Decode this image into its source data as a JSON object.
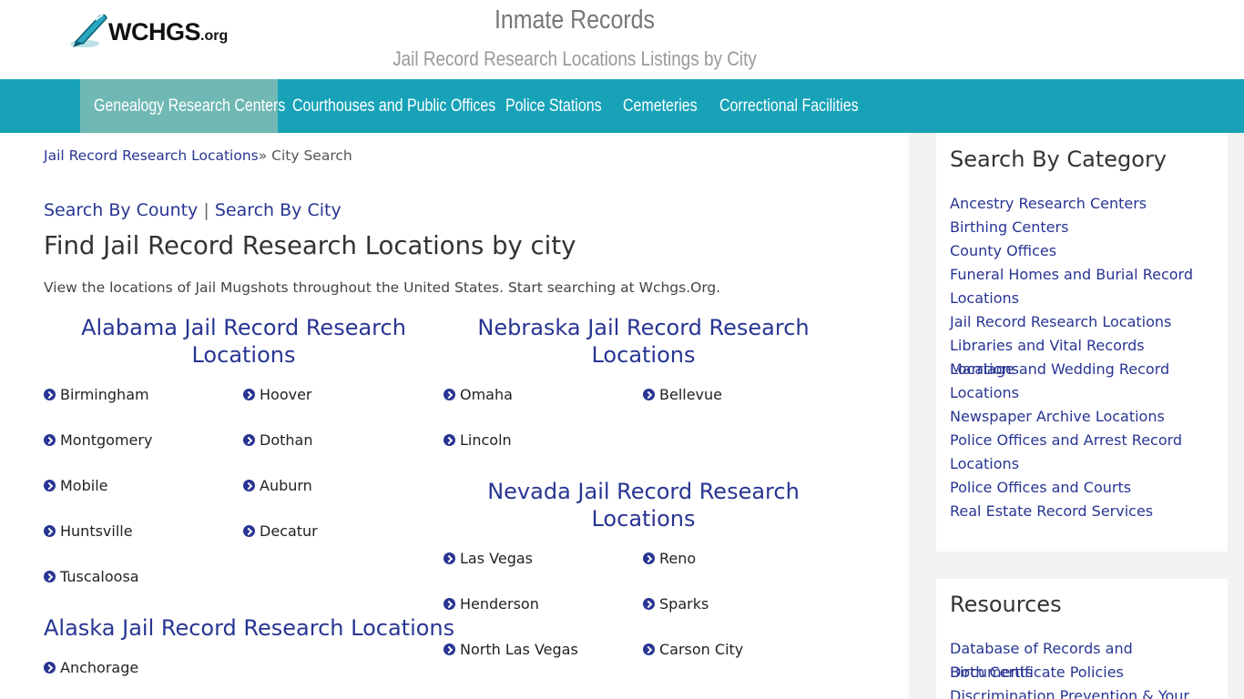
{
  "header": {
    "logo_text": "WCHGS",
    "logo_tld": ".org",
    "title": "Inmate Records",
    "subtitle": "Jail Record Research Locations Listings by City"
  },
  "nav": {
    "items": [
      {
        "label": "Genealogy Research Centers"
      },
      {
        "label": "Courthouses and Public Offices"
      },
      {
        "label": "Police Stations"
      },
      {
        "label": "Cemeteries"
      },
      {
        "label": "Correctional Facilities"
      }
    ]
  },
  "main": {
    "breadcrumb": {
      "link": "Jail Record Research Locations",
      "separator": "» City Search"
    },
    "search_by_county": "Search By County",
    "search_separator": "|",
    "search_by_city": "Search By City",
    "title": "Find Jail Record Research Locations by city",
    "intro": "View the locations of Jail Mugshots throughout the United States. Start searching at Wchgs.Org.",
    "states": [
      {
        "title": "Alabama Jail Record Research Locations",
        "cities": [
          "Birmingham",
          "Hoover",
          "Montgomery",
          "Dothan",
          "Mobile",
          "Auburn",
          "Huntsville",
          "Decatur",
          "Tuscaloosa"
        ]
      },
      {
        "title": "Alaska Jail Record Research Locations",
        "cities": [
          "Anchorage"
        ]
      },
      {
        "title": "Nebraska Jail Record Research Locations",
        "cities": [
          "Omaha",
          "Bellevue",
          "Lincoln"
        ]
      },
      {
        "title": "Nevada Jail Record Research Locations",
        "cities": [
          "Las Vegas",
          "Reno",
          "Henderson",
          "Sparks",
          "North Las Vegas",
          "Carson City"
        ]
      }
    ]
  },
  "sidebar": {
    "category": {
      "title": "Search By Category",
      "links": [
        "Ancestry Research Centers",
        "Birthing Centers",
        "County Offices",
        "Funeral Homes and Burial Record Locations",
        "Jail Record Research Locations",
        "Libraries and Vital Records Locations",
        "Marriage and Wedding Record Locations",
        "Newspaper Archive Locations",
        "Police Offices and Arrest Record Locations",
        "Police Offices and Courts",
        "Real Estate Record Services"
      ]
    },
    "resources": {
      "title": "Resources",
      "links": [
        "Database of Records and Documents",
        "Birth Certificate Policies",
        "Discrimination Prevention & Your"
      ]
    }
  },
  "colors": {
    "nav_bg": "#17a2b8",
    "nav_active": "#6fb8b4",
    "link": "#283593",
    "sidebar_bg": "#f2f2f2"
  }
}
